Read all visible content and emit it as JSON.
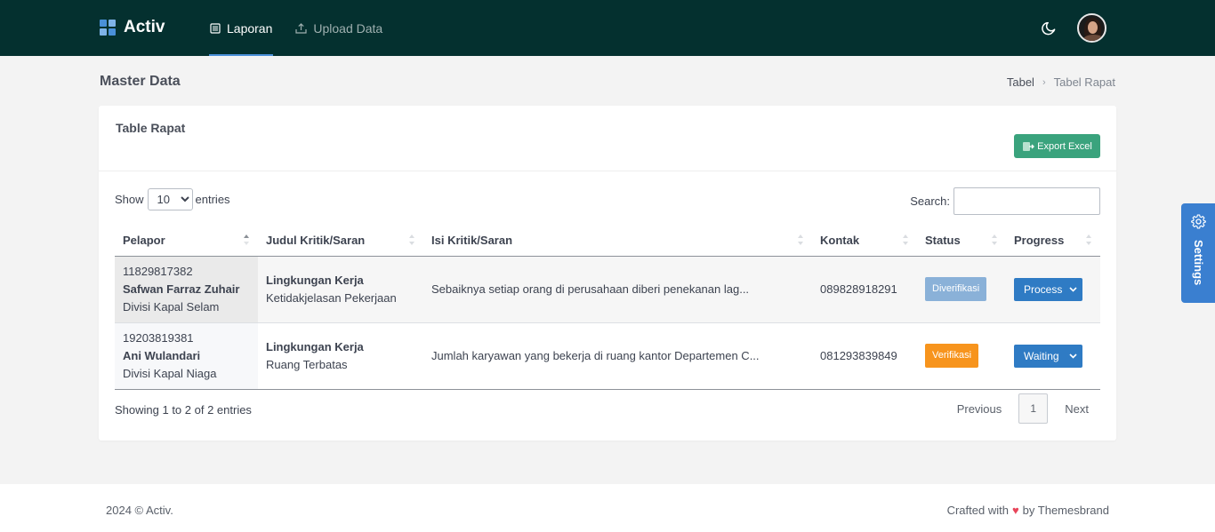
{
  "app": {
    "name": "Activ"
  },
  "nav": {
    "items": [
      {
        "label": "Laporan",
        "icon": "list-icon",
        "active": true
      },
      {
        "label": "Upload Data",
        "icon": "upload-icon",
        "active": false
      }
    ]
  },
  "header": {
    "theme_toggle_icon": "moon-icon",
    "avatar_icon": "user-avatar"
  },
  "page": {
    "title": "Master Data"
  },
  "breadcrumb": {
    "items": [
      "Tabel",
      "Tabel Rapat"
    ]
  },
  "card": {
    "title": "Table Rapat",
    "export_label": "Export Excel"
  },
  "controls": {
    "show_label": "Show",
    "entries_label": "entries",
    "page_size": "10",
    "search_label": "Search:",
    "search_value": ""
  },
  "table": {
    "headers": [
      "Pelapor",
      "Judul Kritik/Saran",
      "Isi Kritik/Saran",
      "Kontak",
      "Status",
      "Progress"
    ],
    "rows": [
      {
        "id": "11829817382",
        "name": "Safwan Farraz Zuhair",
        "division": "Divisi Kapal Selam",
        "judul_title": "Lingkungan Kerja",
        "judul_sub": "Ketidakjelasan Pekerjaan",
        "isi": "Sebaiknya setiap orang di perusahaan diberi penekanan lag...",
        "kontak": "089828918291",
        "status": "Diverifikasi",
        "progress": "Process"
      },
      {
        "id": "19203819381",
        "name": "Ani Wulandari",
        "division": "Divisi Kapal Niaga",
        "judul_title": "Lingkungan Kerja",
        "judul_sub": "Ruang Terbatas",
        "isi": "Jumlah karyawan yang bekerja di ruang kantor Departemen C...",
        "kontak": "081293839849",
        "status": "Verifikasi",
        "progress": "Waiting"
      }
    ]
  },
  "pagination": {
    "info": "Showing 1 to 2 of 2 entries",
    "previous": "Previous",
    "current": "1",
    "next": "Next"
  },
  "settings": {
    "label": "Settings"
  },
  "footer": {
    "copyright": "2024 © Activ.",
    "crafted_prefix": "Crafted with",
    "crafted_suffix": "by Themesbrand"
  },
  "colors": {
    "topbar": "#04302f",
    "accent": "#3a7fd0",
    "export": "#3aa37d",
    "status_verified": "#8ab1d8",
    "status_verify": "#f7941d",
    "progress": "#2f7bc4"
  }
}
